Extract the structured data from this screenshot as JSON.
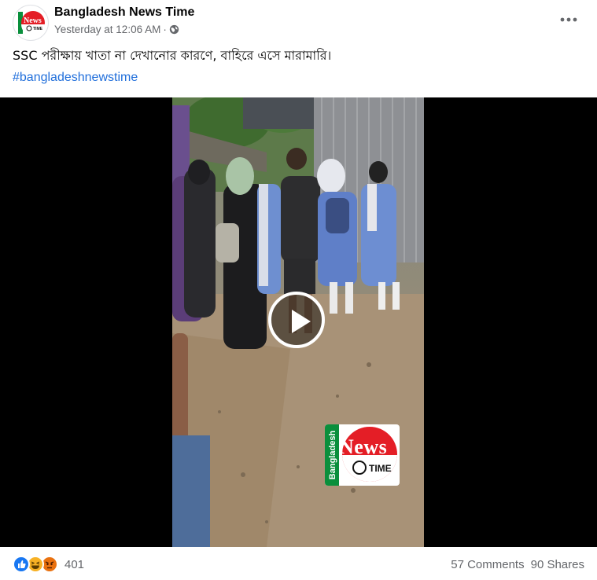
{
  "post": {
    "page_name": "Bangladesh News Time",
    "timestamp": "Yesterday at 12:06 AM",
    "separator": "·",
    "privacy_icon": "globe-icon",
    "more_icon": "more-dots-icon",
    "caption": "SSC পরীক্ষায় খাতা না দেখানোর কারণে, বাহিরে এসে  মারামারি।",
    "hashtag": "#bangladeshnewstime"
  },
  "avatar_logo": {
    "word": "News",
    "sub": "TIME",
    "side": "Bangladesh"
  },
  "video": {
    "play_icon": "play-icon",
    "watermark": {
      "side_text": "Bangladesh",
      "word": "News",
      "sub": "TIME"
    }
  },
  "footer": {
    "reaction_icons": [
      "like-icon",
      "haha-icon",
      "angry-icon"
    ],
    "reaction_count": "401",
    "comments": "57 Comments",
    "shares": "90 Shares"
  },
  "colors": {
    "brand_blue": "#1877f2",
    "hashtag": "#216fdb",
    "secondary_text": "#65676b",
    "logo_red": "#e41e26",
    "logo_green": "#0a8f3c"
  }
}
